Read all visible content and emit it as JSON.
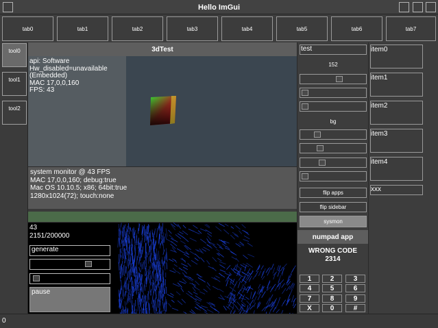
{
  "window": {
    "title": "Hello ImGui"
  },
  "tabs": [
    "tab0",
    "tab1",
    "tab2",
    "tab3",
    "tab4",
    "tab5",
    "tab6",
    "tab7"
  ],
  "tools": [
    "tool0",
    "tool1",
    "tool2"
  ],
  "test3d": {
    "title": "3dTest",
    "info": [
      "api: Software",
      "Hw_disabled=unavailable",
      "(Embedded)",
      "MAC 17,0,0,160",
      "FPS: 43"
    ],
    "sysmon": [
      "system monitor @ 43 FPS",
      "MAC 17,0,0,160; debug:true",
      "Mac OS 10.10.5; x86; 64bit:true",
      "1280x1024(72); touch:none"
    ]
  },
  "generator": {
    "count": "43",
    "progress": "2151/200000",
    "generate_label": "generate",
    "pause_label": "pause",
    "slider_value": 0.73
  },
  "controls": {
    "test_label": "test",
    "number_value": "152",
    "bg_label": "bg",
    "flip_apps_label": "flip apps",
    "flip_sidebar_label": "flip sidebar",
    "sysmon_label": "sysmon"
  },
  "numpad": {
    "title": "numpad app",
    "message_line1": "WRONG CODE",
    "message_line2": "2314",
    "keys": [
      "1",
      "2",
      "3",
      "4",
      "5",
      "6",
      "7",
      "8",
      "9",
      "X",
      "0",
      "#"
    ]
  },
  "items": [
    "item0",
    "item1",
    "item2",
    "item3",
    "item4"
  ],
  "items_input_value": "xxx",
  "statusbar": {
    "text": "0"
  },
  "colors": {
    "background": "#3d3d3d",
    "accent_blue": "#1a3fd6",
    "green_bar": "#4b6b49"
  }
}
